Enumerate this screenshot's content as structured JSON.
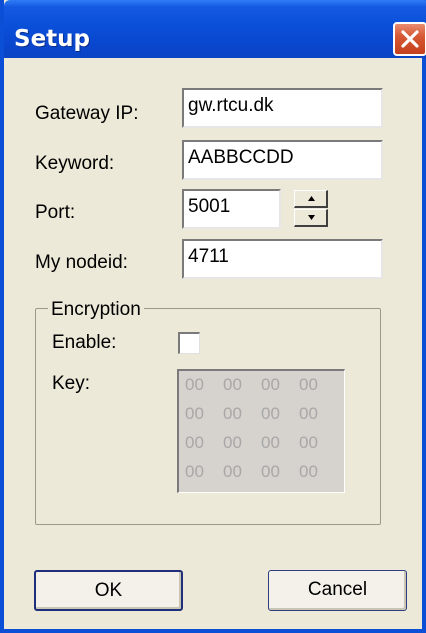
{
  "window": {
    "title": "Setup"
  },
  "fields": {
    "gateway_ip": {
      "label": "Gateway IP:",
      "value": "gw.rtcu.dk"
    },
    "keyword": {
      "label": "Keyword:",
      "value": "AABBCCDD"
    },
    "port": {
      "label": "Port:",
      "value": "5001"
    },
    "nodeid": {
      "label": "My nodeid:",
      "value": "4711"
    }
  },
  "encryption": {
    "group_label": "Encryption",
    "enable_label": "Enable:",
    "enabled": false,
    "key_label": "Key:",
    "key_rows": [
      [
        "00",
        "00",
        "00",
        "00"
      ],
      [
        "00",
        "00",
        "00",
        "00"
      ],
      [
        "00",
        "00",
        "00",
        "00"
      ],
      [
        "00",
        "00",
        "00",
        "00"
      ]
    ]
  },
  "buttons": {
    "ok": "OK",
    "cancel": "Cancel"
  },
  "colors": {
    "titlebar": "#0a4fd8",
    "close_button": "#d65a35",
    "dialog_bg": "#ece9d8"
  },
  "icons": {
    "close": "close-x-icon",
    "spin_up": "caret-up-icon",
    "spin_down": "caret-down-icon"
  }
}
